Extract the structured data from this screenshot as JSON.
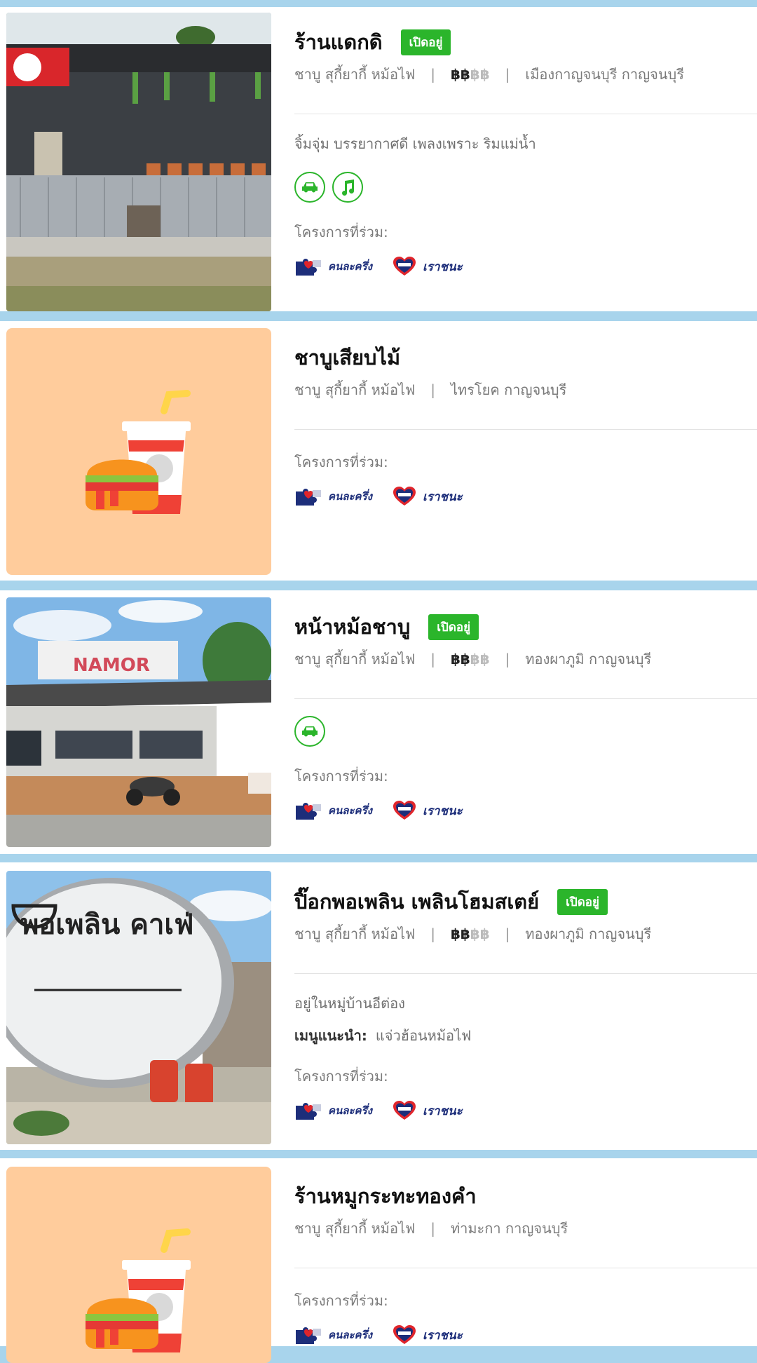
{
  "programs_label": "โครงการที่ร่วม:",
  "program_names": [
    "คนละครึ่ง",
    "เราชนะ"
  ],
  "colors": {
    "background_blue": "#a8d4ec",
    "open_green": "#2bb52b",
    "placeholder_peach": "#ffcc9c",
    "program_navy": "#1d2e7a"
  },
  "listings": [
    {
      "name": "ร้านแดกดิ",
      "open_badge": "เปิดอยู่",
      "category": "ชาบู สุกี้ยากี้ หม้อไฟ",
      "price_on": "฿฿",
      "price_off": "฿฿",
      "location": "เมืองกาญจนบุรี กาญจนบุรี",
      "description": "จิ้มจุ่ม บรรยากาศดี เพลงเพราะ ริมแม่น้ำ",
      "facilities": [
        "car-icon",
        "music-icon"
      ],
      "image": "photo"
    },
    {
      "name": "ชาบูเสียบไม้",
      "category": "ชาบู สุกี้ยากี้ หม้อไฟ",
      "location": "ไทรโยค กาญจนบุรี",
      "image": "placeholder-burger-drink"
    },
    {
      "name": "หน้าหม้อชาบู",
      "open_badge": "เปิดอยู่",
      "category": "ชาบู สุกี้ยากี้ หม้อไฟ",
      "price_on": "฿฿",
      "price_off": "฿฿",
      "location": "ทองผาภูมิ กาญจนบุรี",
      "facilities": [
        "car-icon"
      ],
      "image": "photo",
      "image_sign_text": "NAMOR"
    },
    {
      "name": "ปิ๊อกพอเพลิน เพลินโฮมสเตย์",
      "open_badge": "เปิดอยู่",
      "category": "ชาบู สุกี้ยากี้ หม้อไฟ",
      "price_on": "฿฿",
      "price_off": "฿฿",
      "location": "ทองผาภูมิ กาญจนบุรี",
      "description": "อยู่ในหมู่บ้านอีต่อง",
      "recommend_label": "เมนูแนะนำ:",
      "recommend_value": "แจ่วฮ้อนหม้อไฟ",
      "image": "photo",
      "image_sign_text": "พอเพลิน คาเฟ่"
    },
    {
      "name": "ร้านหมูกระทะทองคำ",
      "category": "ชาบู สุกี้ยากี้ หม้อไฟ",
      "location": "ท่ามะกา กาญจนบุรี",
      "image": "placeholder-burger-drink"
    }
  ]
}
